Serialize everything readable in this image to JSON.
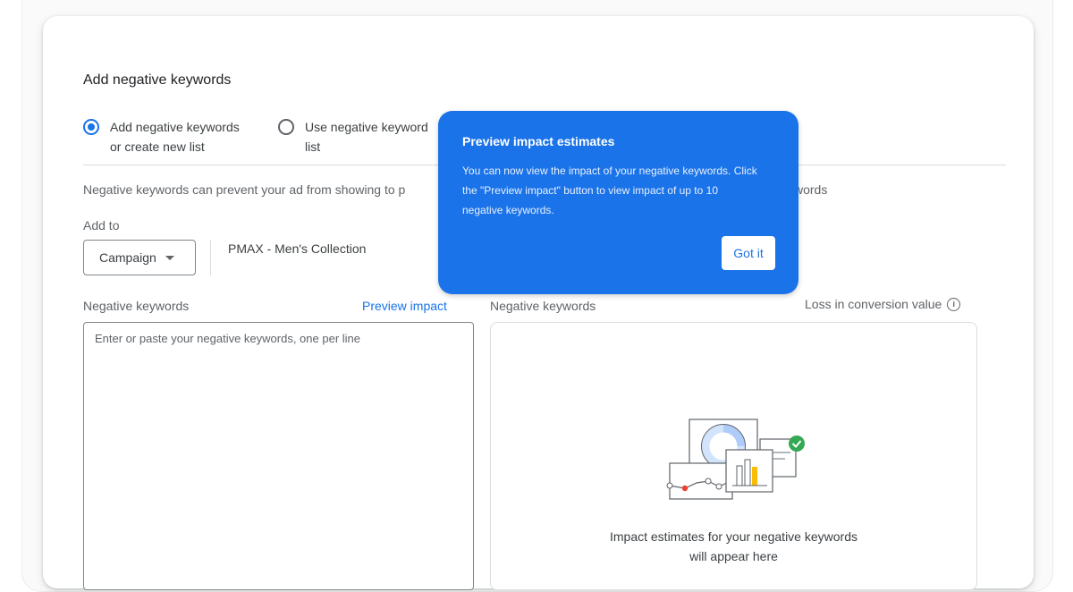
{
  "dialog": {
    "title": "Add negative keywords",
    "options": [
      {
        "line1": "Add negative keywords",
        "line2": "or create new list",
        "selected": true
      },
      {
        "line1": "Use negative keyword",
        "line2": "list",
        "selected": false
      }
    ],
    "description": "Negative keywords can prevent your ad from showing to p",
    "description_tail": "words",
    "add_to_label": "Add to",
    "dropdown_value": "Campaign",
    "campaign_name": "PMAX - Men's Collection",
    "left_column_label": "Negative keywords",
    "preview_impact_link": "Preview impact",
    "right_column_label": "Negative keywords",
    "loss_label": "Loss in conversion value",
    "textarea_placeholder": "Enter or paste your negative keywords, one per line",
    "empty_state": {
      "line1": "Impact estimates for your negative keywords",
      "line2": "will appear here"
    },
    "info_icon": "info-icon",
    "illustration_icon": "charts-illustration-icon"
  },
  "popover": {
    "title": "Preview impact estimates",
    "body": "You can now view the impact of your negative keywords. Click the \"Preview impact\" button to view impact of up to 10 negative keywords.",
    "button_label": "Got it"
  },
  "colors": {
    "accent": "#1a73e8",
    "check_green": "#34a853",
    "bar_yellow": "#fbbc04",
    "dot_red": "#ea4335"
  }
}
